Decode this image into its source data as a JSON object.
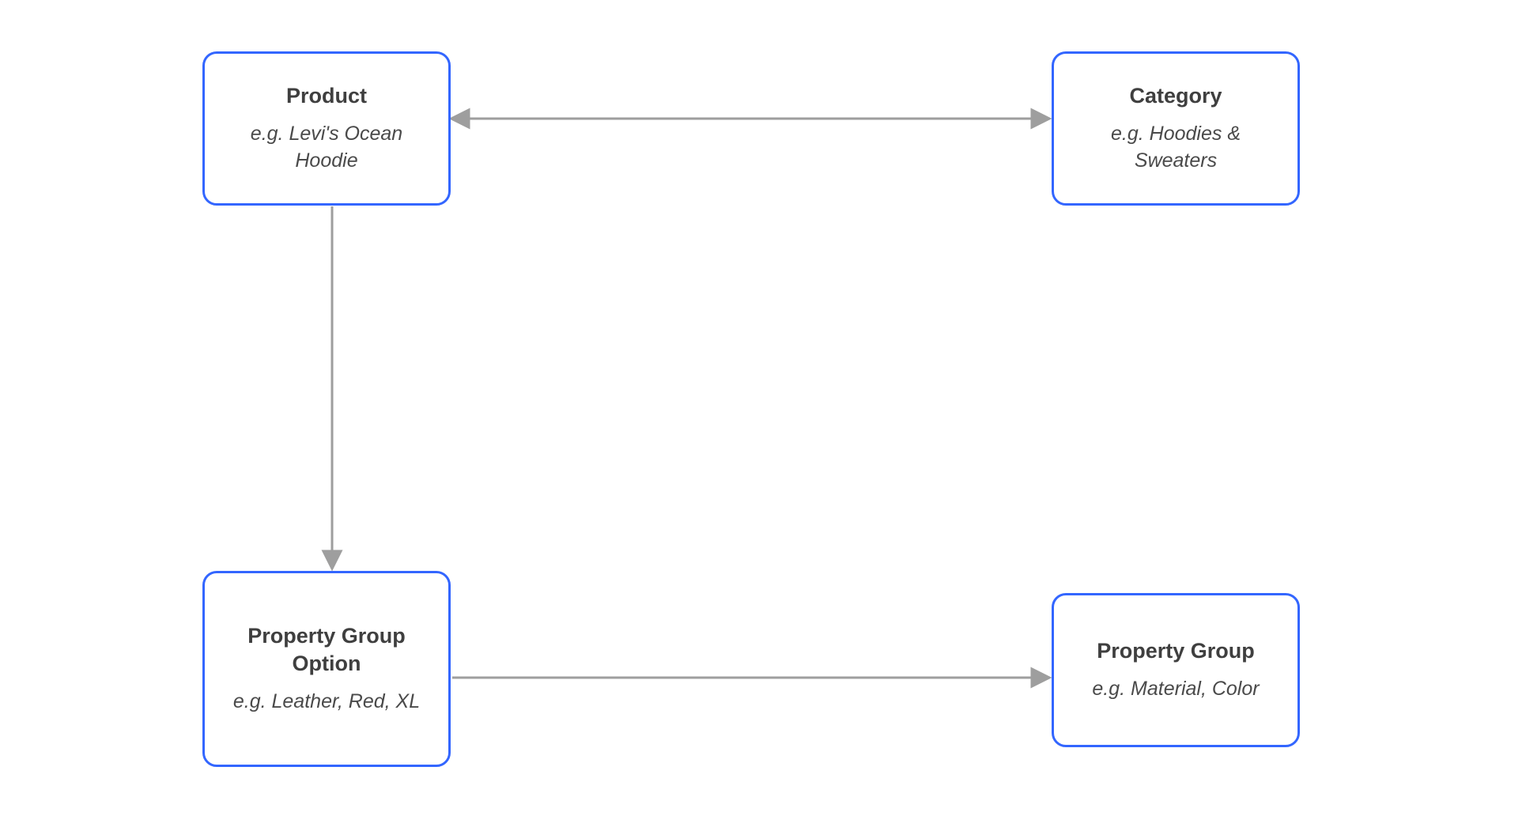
{
  "nodes": {
    "product": {
      "title": "Product",
      "example": "e.g. Levi's Ocean Hoodie"
    },
    "category": {
      "title": "Category",
      "example": "e.g. Hoodies & Sweaters"
    },
    "property_group_option": {
      "title": "Property Group Option",
      "example": "e.g. Leather, Red, XL"
    },
    "property_group": {
      "title": "Property Group",
      "example": "e.g. Material, Color"
    }
  },
  "edges": [
    {
      "from": "product",
      "to": "category",
      "bidirectional": true
    },
    {
      "from": "product",
      "to": "property_group_option",
      "bidirectional": false
    },
    {
      "from": "property_group_option",
      "to": "property_group",
      "bidirectional": false
    }
  ],
  "colors": {
    "node_border": "#3366ff",
    "edge": "#9e9e9e",
    "text": "#3f3f3f"
  }
}
